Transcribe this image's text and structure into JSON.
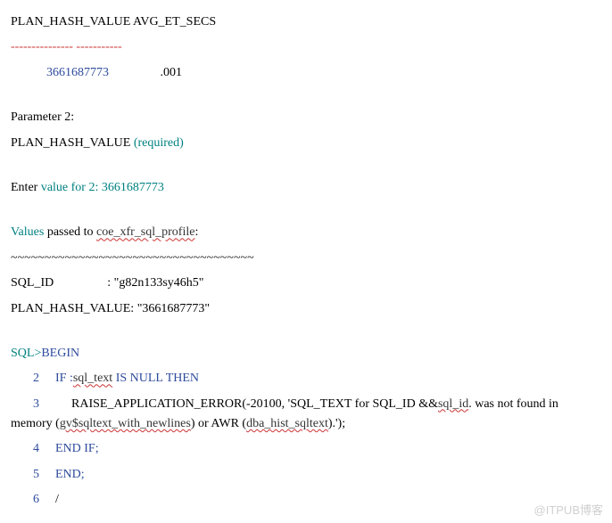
{
  "header": "PLAN_HASH_VALUE AVG_ET_SECS",
  "divider": "--------------- -----------",
  "row": {
    "hash": "3661687773",
    "secs": ".001"
  },
  "param2_label": "Parameter 2:",
  "param2_field": "PLAN_HASH_VALUE",
  "required": " (required)",
  "enter_prefix": "Enter ",
  "enter_value": "value for 2: 3661687773",
  "values_word": "Values",
  "passed_to": " passed to ",
  "profile_name": "coe_xfr_sql_profile",
  "colon": ":",
  "tildes": "~~~~~~~~~~~~~~~~~~~~~~~~~~~~~~~~~~~~",
  "sqlid_label": "SQL_ID",
  "sqlid_value": ": \"g82n133sy46h5\"",
  "phv_label": "PLAN_HASH_VALUE: \"3661687773\"",
  "sql_prompt": "SQL>",
  "begin_kw": "BEGIN",
  "line2_num": "2",
  "line2_if": "IF :",
  "line2_sqltext": "sql_text",
  "line2_isnull": " IS NULL THEN",
  "line3_num": "3",
  "line3_raise": "RAISE_APPLICATION_ERROR(-20100, 'SQL_TEXT for SQL_ID &&",
  "line3_sqlid": "sql_id",
  "line3_notfound": ". was not found in memory (",
  "line3_gvtext": "gv$sqltext_with_newlines",
  "line3_orawr": ") or AWR (",
  "line3_dbahist": "dba_hist_sqltext",
  "line3_end": ").');",
  "line4_num": "4",
  "line4_endif": "END IF;",
  "line5_num": "5",
  "line5_end": "END;",
  "line6_num": "6",
  "line6_slash": "/",
  "watermark": "@ITPUB博客"
}
